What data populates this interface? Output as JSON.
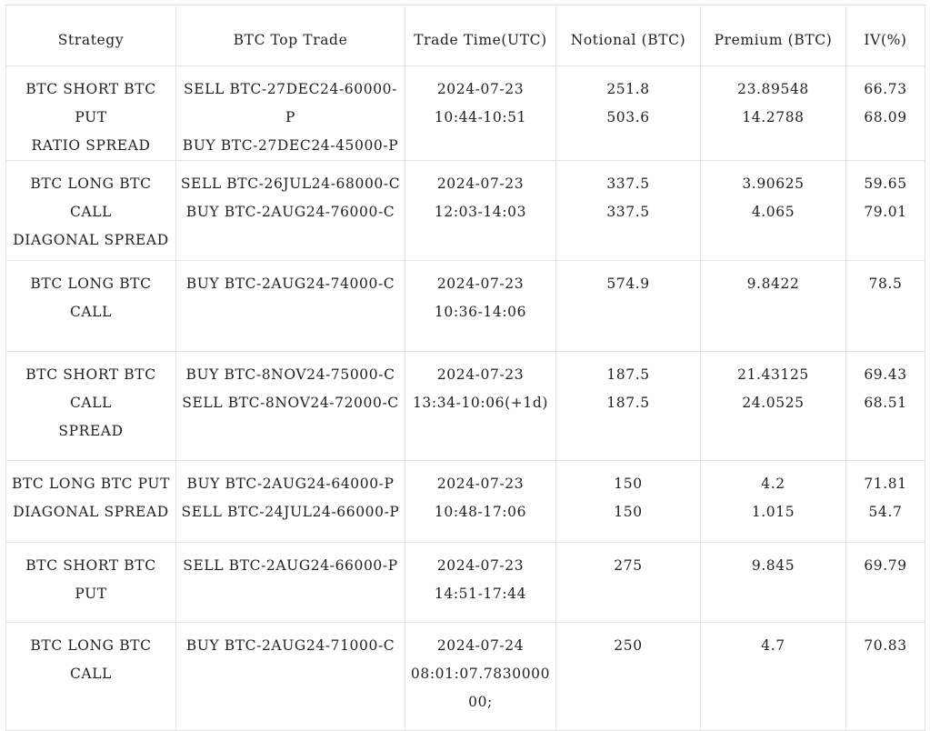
{
  "table": {
    "columns": [
      {
        "key": "strategy",
        "label": "Strategy"
      },
      {
        "key": "top_trade",
        "label": "BTC Top Trade"
      },
      {
        "key": "trade_time",
        "label": "Trade Time(UTC)"
      },
      {
        "key": "notional",
        "label": "Notional (BTC)"
      },
      {
        "key": "premium",
        "label": "Premium (BTC)"
      },
      {
        "key": "iv",
        "label": "IV(%)"
      }
    ],
    "rows": [
      {
        "strategy": [
          "BTC SHORT BTC PUT",
          "RATIO SPREAD"
        ],
        "top_trade": [
          "SELL BTC-27DEC24-60000-P",
          "BUY BTC-27DEC24-45000-P"
        ],
        "trade_time": [
          "2024-07-23",
          "10:44-10:51"
        ],
        "notional": [
          "251.8",
          "503.6"
        ],
        "premium": [
          "23.89548",
          "14.2788"
        ],
        "iv": [
          "66.73",
          "68.09"
        ]
      },
      {
        "strategy": [
          "BTC LONG BTC CALL",
          "DIAGONAL SPREAD"
        ],
        "top_trade": [
          "SELL BTC-26JUL24-68000-C",
          "BUY BTC-2AUG24-76000-C"
        ],
        "trade_time": [
          "2024-07-23",
          "12:03-14:03"
        ],
        "notional": [
          "337.5",
          "337.5"
        ],
        "premium": [
          "3.90625",
          "4.065"
        ],
        "iv": [
          "59.65",
          "79.01"
        ]
      },
      {
        "strategy": [
          "BTC LONG BTC CALL"
        ],
        "top_trade": [
          "BUY BTC-2AUG24-74000-C"
        ],
        "trade_time": [
          "2024-07-23",
          "10:36-14:06"
        ],
        "notional": [
          "574.9"
        ],
        "premium": [
          "9.8422"
        ],
        "iv": [
          "78.5"
        ]
      },
      {
        "strategy": [
          "BTC SHORT BTC CALL",
          "SPREAD"
        ],
        "top_trade": [
          "BUY BTC-8NOV24-75000-C",
          "SELL BTC-8NOV24-72000-C"
        ],
        "trade_time": [
          "2024-07-23",
          "13:34-10:06(+1d)"
        ],
        "notional": [
          "187.5",
          "187.5"
        ],
        "premium": [
          "21.43125",
          "24.0525"
        ],
        "iv": [
          "69.43",
          "68.51"
        ]
      },
      {
        "strategy": [
          "BTC LONG BTC PUT",
          "DIAGONAL SPREAD"
        ],
        "top_trade": [
          "BUY BTC-2AUG24-64000-P",
          "SELL BTC-24JUL24-66000-P"
        ],
        "trade_time": [
          "2024-07-23",
          "10:48-17:06"
        ],
        "notional": [
          "150",
          "150"
        ],
        "premium": [
          "4.2",
          "1.015"
        ],
        "iv": [
          "71.81",
          "54.7"
        ]
      },
      {
        "strategy": [
          "BTC SHORT BTC PUT"
        ],
        "top_trade": [
          "SELL BTC-2AUG24-66000-P"
        ],
        "trade_time": [
          "2024-07-23",
          "14:51-17:44"
        ],
        "notional": [
          "275"
        ],
        "premium": [
          "9.845"
        ],
        "iv": [
          "69.79"
        ]
      },
      {
        "strategy": [
          "BTC LONG BTC CALL"
        ],
        "top_trade": [
          "BUY BTC-2AUG24-71000-C"
        ],
        "trade_time": [
          "2024-07-24",
          "08:01:07.783000000;"
        ],
        "notional": [
          "250"
        ],
        "premium": [
          "4.7"
        ],
        "iv": [
          "70.83"
        ]
      }
    ]
  },
  "style": {
    "border_color": "#e3e3e3",
    "text_color": "#1f1f1f",
    "background": "#ffffff"
  }
}
